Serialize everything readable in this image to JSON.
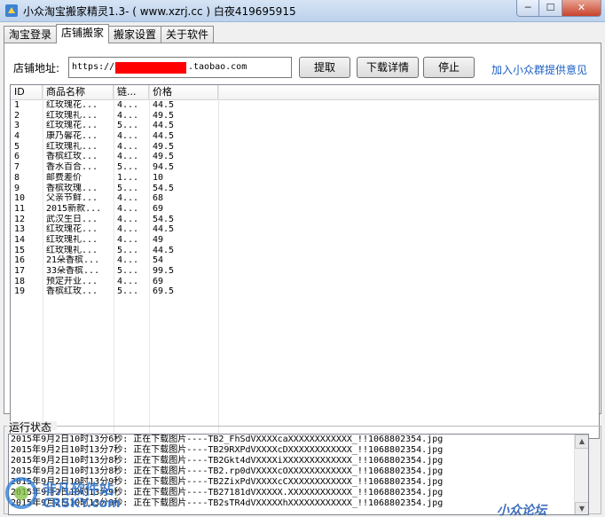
{
  "window": {
    "title": "小众淘宝搬家精灵1.3- ( www.xzrj.cc ) 白夜419695915",
    "min_glyph": "─",
    "max_glyph": "☐",
    "close_glyph": "✕"
  },
  "tabs": [
    {
      "label": "淘宝登录"
    },
    {
      "label": "店铺搬家"
    },
    {
      "label": "搬家设置"
    },
    {
      "label": "关于软件"
    }
  ],
  "active_tab": "店铺搬家",
  "shop": {
    "address_label": "店铺地址:",
    "address_prefix": "https://",
    "address_suffix": ".taobao.com"
  },
  "buttons": {
    "extract": "提取",
    "download_details": "下载详情",
    "stop": "停止",
    "feedback_link": "加入小众群提供意见"
  },
  "table": {
    "columns": [
      "ID",
      "商品名称",
      "链...",
      "价格"
    ],
    "rows": [
      [
        "1",
        "红玫瑰花...",
        "4...",
        "44.5"
      ],
      [
        "2",
        "红玫瑰礼...",
        "4...",
        "49.5"
      ],
      [
        "3",
        "红玫瑰花...",
        "5...",
        "44.5"
      ],
      [
        "4",
        "康乃馨花...",
        "4...",
        "44.5"
      ],
      [
        "5",
        "红玫瑰礼...",
        "4...",
        "49.5"
      ],
      [
        "6",
        "香槟红玫...",
        "4...",
        "49.5"
      ],
      [
        "7",
        "香水百合...",
        "5...",
        "94.5"
      ],
      [
        "8",
        "邮费差价",
        "1...",
        "10"
      ],
      [
        "9",
        "香槟玫瑰...",
        "5...",
        "54.5"
      ],
      [
        "10",
        "父亲节鲜...",
        "4...",
        "68"
      ],
      [
        "11",
        "2015新款...",
        "4...",
        "69"
      ],
      [
        "12",
        "武汉生日...",
        "4...",
        "54.5"
      ],
      [
        "13",
        "红玫瑰花...",
        "4...",
        "44.5"
      ],
      [
        "14",
        "红玫瑰礼...",
        "4...",
        "49"
      ],
      [
        "15",
        "红玫瑰礼...",
        "5...",
        "44.5"
      ],
      [
        "16",
        "21朵香槟...",
        "4...",
        "54"
      ],
      [
        "17",
        "33朵香槟...",
        "5...",
        "99.5"
      ],
      [
        "18",
        "预定开业...",
        "4...",
        "69"
      ],
      [
        "19",
        "香槟红玫...",
        "5...",
        "69.5"
      ]
    ]
  },
  "status": {
    "label": "运行状态",
    "log": [
      "2015年9月2日10时13分6秒: 正在下载图片----TB2_FhSdVXXXXcaXXXXXXXXXXXX_!!1068802354.jpg",
      "2015年9月2日10时13分7秒: 正在下载图片----TB29RXPdVXXXXcDXXXXXXXXXXXX_!!1068802354.jpg",
      "2015年9月2日10时13分8秒: 正在下载图片----TB2Gkt4dVXXXXiXXXXXXXXXXXXX_!!1068802354.jpg",
      "2015年9月2日10时13分8秒: 正在下载图片----TB2.rp0dVXXXXcOXXXXXXXXXXXX_!!1068802354.jpg",
      "2015年9月2日10时13分9秒: 正在下载图片----TB2ZixPdVXXXXcCXXXXXXXXXXXX_!!1068802354.jpg",
      "2015年9月2日10时13分9秒: 正在下载图片----TB27181dVXXXXX.XXXXXXXXXXXX_!!1068802354.jpg",
      "2015年9月2日10时13分9秒: 正在下载图片----TB2sTR4dVXXXXXhXXXXXXXXXXXX_!!1068802354.jpg"
    ],
    "scroll_up": "▲",
    "scroll_down": "▼"
  },
  "watermarks": {
    "left_brand": "非凡软件站",
    "left_url": "CRSKY.com",
    "right_brand": "小众论坛"
  },
  "colors": {
    "accent_link": "#1a5fc4",
    "redaction": "#ff0000"
  }
}
